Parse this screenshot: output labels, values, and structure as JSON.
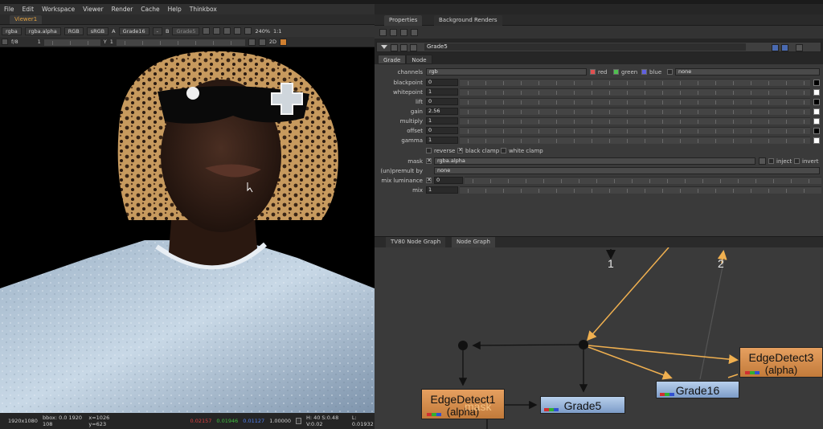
{
  "menu": [
    "File",
    "Edit",
    "Workspace",
    "Viewer",
    "Render",
    "Cache",
    "Help",
    "Thinkbox"
  ],
  "viewer": {
    "tab": "Viewer1",
    "channels": "rgba",
    "layer": "rgba.alpha",
    "display": "RGB",
    "lut": "sRGB",
    "input_a_label": "A",
    "input_a": "Grade16",
    "input_a_blend": "-",
    "input_b_label": "B",
    "input_b": "Grade5",
    "zoom": "240%",
    "ratio": "1:1",
    "fstop_label": "f/8",
    "frame": "1",
    "y_label": "Y",
    "y_value": "1",
    "view_mode": "2D",
    "status": {
      "format": "1920x1080",
      "bbox": "bbox: 0.0 1920 108",
      "coords": "x=1026 y=623",
      "r": "0.02157",
      "g": "0.01946",
      "b": "0.01127",
      "a": "1.00000",
      "hsv": "H: 40 S:0.48 V:0.02",
      "lum": "L: 0.01932"
    }
  },
  "properties": {
    "tabs": [
      "Properties",
      "Background Renders"
    ],
    "node_name": "Grade5",
    "node_tabs": [
      "Grade",
      "Node"
    ],
    "channels_label": "channels",
    "channels_value": "rgb",
    "channel_flags": [
      {
        "label": "red",
        "color": "#e05050"
      },
      {
        "label": "green",
        "color": "#50c050"
      },
      {
        "label": "blue",
        "color": "#6060e0"
      }
    ],
    "channels_extra": "none",
    "params": [
      {
        "label": "blackpoint",
        "value": "0"
      },
      {
        "label": "whitepoint",
        "value": "1"
      },
      {
        "label": "lift",
        "value": "0"
      },
      {
        "label": "gain",
        "value": "2.56"
      },
      {
        "label": "multiply",
        "value": "1"
      },
      {
        "label": "offset",
        "value": "0"
      },
      {
        "label": "gamma",
        "value": "1"
      }
    ],
    "reverse": "reverse",
    "black_clamp": "black clamp",
    "white_clamp": "white clamp",
    "mask_label": "mask",
    "mask_value": "rgba.alpha",
    "inject": "inject",
    "invert": "invert",
    "unpremult_label": "(un)premult by",
    "unpremult_value": "none",
    "mix_lum_label": "mix luminance",
    "mix_lum_value": "0",
    "mix_label": "mix",
    "mix_value": "1"
  },
  "nodegraph": {
    "tabs": [
      "TV80 Node Graph",
      "Node Graph"
    ],
    "label_1": "1",
    "label_2": "2",
    "edge1_name": "EdgeDetect1",
    "edge1_sub": "(alpha)",
    "mask_tag": "mask",
    "grade5": "Grade5",
    "grade16": "Grade16",
    "edge3_name": "EdgeDetect3",
    "edge3_sub": "(alpha)"
  }
}
